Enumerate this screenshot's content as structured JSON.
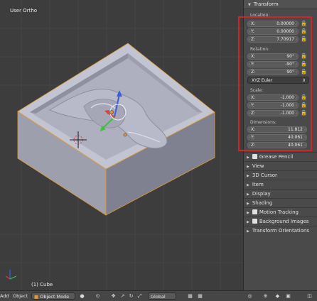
{
  "viewport": {
    "title": "User Ortho",
    "status": "(1) Cube"
  },
  "panel": {
    "header": "Transform",
    "location": {
      "label": "Location:",
      "fields": [
        {
          "axis": "X:",
          "value": "0.00000"
        },
        {
          "axis": "Y:",
          "value": "0.00000"
        },
        {
          "axis": "Z:",
          "value": "7.70917"
        }
      ]
    },
    "rotation": {
      "label": "Rotation:",
      "fields": [
        {
          "axis": "X:",
          "value": "90°"
        },
        {
          "axis": "Y:",
          "value": "-90°"
        },
        {
          "axis": "Z:",
          "value": "90°"
        }
      ]
    },
    "rotation_mode": "XYZ Euler",
    "scale": {
      "label": "Scale:",
      "fields": [
        {
          "axis": "X:",
          "value": "-1.000"
        },
        {
          "axis": "Y:",
          "value": "-1.000"
        },
        {
          "axis": "Z:",
          "value": "-1.000"
        }
      ]
    },
    "dimensions": {
      "label": "Dimensions:",
      "fields": [
        {
          "axis": "X:",
          "value": "11.812"
        },
        {
          "axis": "Y:",
          "value": "40.061"
        },
        {
          "axis": "Z:",
          "value": "40.061"
        }
      ]
    },
    "sections": [
      "Grease Pencil",
      "View",
      "3D Cursor",
      "Item",
      "Display",
      "Shading",
      "Motion Tracking",
      "Background Images",
      "Transform Orientations"
    ]
  },
  "toolbar": {
    "add": "Add",
    "object": "Object",
    "mode": "Object Mode",
    "orientation": "Global"
  },
  "colors": {
    "highlight": "#d0232a",
    "object_outline": "#e39b2f"
  }
}
